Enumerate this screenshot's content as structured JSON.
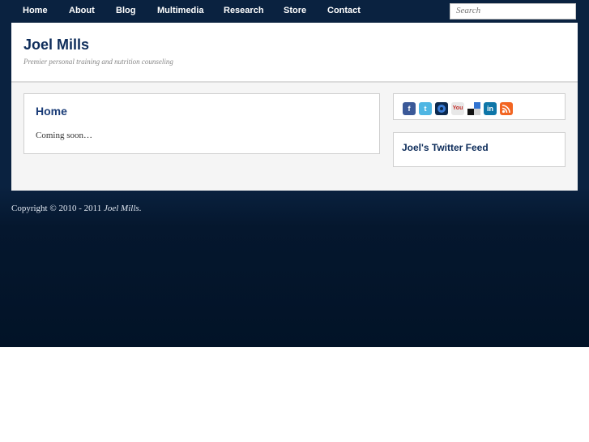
{
  "nav": {
    "items": [
      {
        "label": "Home"
      },
      {
        "label": "About"
      },
      {
        "label": "Blog"
      },
      {
        "label": "Multimedia"
      },
      {
        "label": "Research"
      },
      {
        "label": "Store"
      },
      {
        "label": "Contact"
      }
    ],
    "search_placeholder": "Search"
  },
  "header": {
    "site_title": "Joel Mills",
    "tagline": "Premier personal training and nutrition counseling"
  },
  "main": {
    "title": "Home",
    "text": "Coming soon…"
  },
  "sidebar": {
    "social_icons": [
      "facebook-icon",
      "twitter-icon",
      "myspace-icon",
      "youtube-icon",
      "delicious-icon",
      "linkedin-icon",
      "rss-icon"
    ],
    "twitter_title": "Joel's Twitter Feed"
  },
  "footer": {
    "copyright_prefix": "Copyright © 2010 - 2011",
    "copyright_name": "Joel Mills",
    "copyright_suffix": "."
  },
  "colors": {
    "nav_bg": "#0a2240",
    "title": "#0d2c5a",
    "heading": "#1a3c77"
  }
}
